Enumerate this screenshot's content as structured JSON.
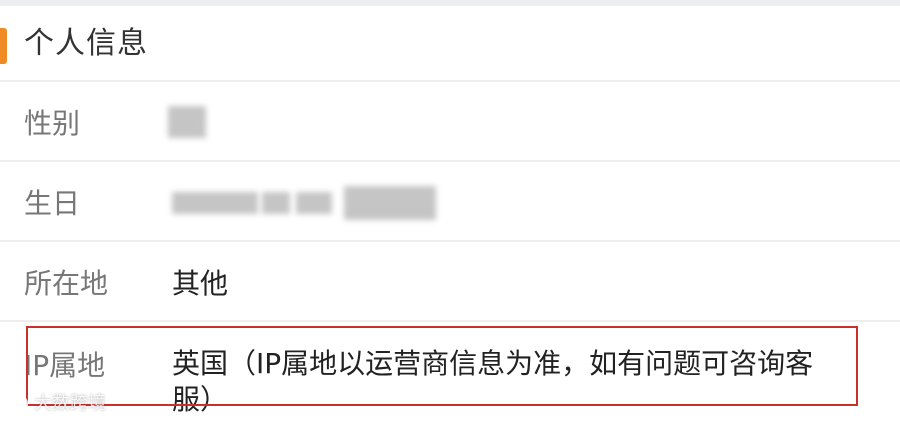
{
  "section": {
    "title": "个人信息"
  },
  "rows": [
    {
      "label": "性别",
      "value": ""
    },
    {
      "label": "生日",
      "value": ""
    },
    {
      "label": "所在地",
      "value": "其他"
    },
    {
      "label": "IP属地",
      "value": "英国（IP属地以运营商信息为准，如有问题可咨询客服）"
    }
  ],
  "watermark": "大数跨境",
  "colors": {
    "accent": "#f08a24",
    "highlight": "#c9302c"
  }
}
